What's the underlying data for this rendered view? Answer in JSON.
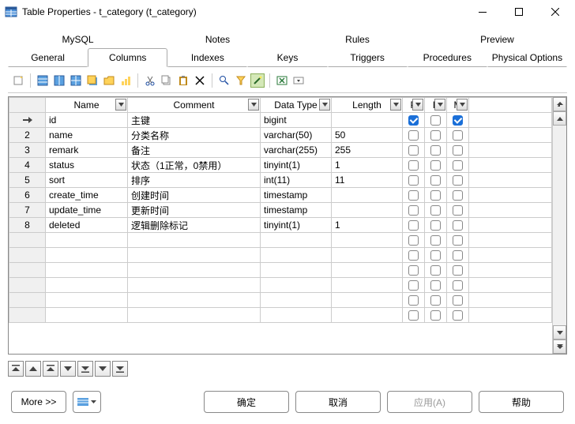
{
  "window": {
    "title": "Table Properties - t_category (t_category)"
  },
  "tabs_top": [
    "MySQL",
    "Notes",
    "Rules",
    "Preview"
  ],
  "tabs_bottom": [
    "General",
    "Columns",
    "Indexes",
    "Keys",
    "Triggers",
    "Procedures",
    "Physical Options"
  ],
  "active_tab": "Columns",
  "headers": {
    "name": "Name",
    "comment": "Comment",
    "datatype": "Data Type",
    "length": "Length",
    "p": "P",
    "f": "F",
    "m": "M"
  },
  "rows": [
    {
      "n": "",
      "arrow": true,
      "name": "id",
      "comment": "主键",
      "datatype": "bigint",
      "length": "",
      "p": true,
      "f": false,
      "m": true
    },
    {
      "n": "2",
      "name": "name",
      "comment": "分类名称",
      "datatype": "varchar(50)",
      "length": "50",
      "p": false,
      "f": false,
      "m": false
    },
    {
      "n": "3",
      "name": "remark",
      "comment": "备注",
      "datatype": "varchar(255)",
      "length": "255",
      "p": false,
      "f": false,
      "m": false
    },
    {
      "n": "4",
      "name": "status",
      "comment": "状态（1正常，0禁用）",
      "datatype": "tinyint(1)",
      "length": "1",
      "p": false,
      "f": false,
      "m": false
    },
    {
      "n": "5",
      "name": "sort",
      "comment": "排序",
      "datatype": "int(11)",
      "length": "11",
      "p": false,
      "f": false,
      "m": false
    },
    {
      "n": "6",
      "name": "create_time",
      "comment": "创建时间",
      "datatype": "timestamp",
      "length": "",
      "p": false,
      "f": false,
      "m": false
    },
    {
      "n": "7",
      "name": "update_time",
      "comment": "更新时间",
      "datatype": "timestamp",
      "length": "",
      "p": false,
      "f": false,
      "m": false
    },
    {
      "n": "8",
      "name": "deleted",
      "comment": "逻辑删除标记",
      "datatype": "tinyint(1)",
      "length": "1",
      "p": false,
      "f": false,
      "m": false
    }
  ],
  "empty_row_count": 6,
  "footer": {
    "more": "More >>",
    "ok": "确定",
    "cancel": "取消",
    "apply": "应用(A)",
    "help": "帮助"
  }
}
